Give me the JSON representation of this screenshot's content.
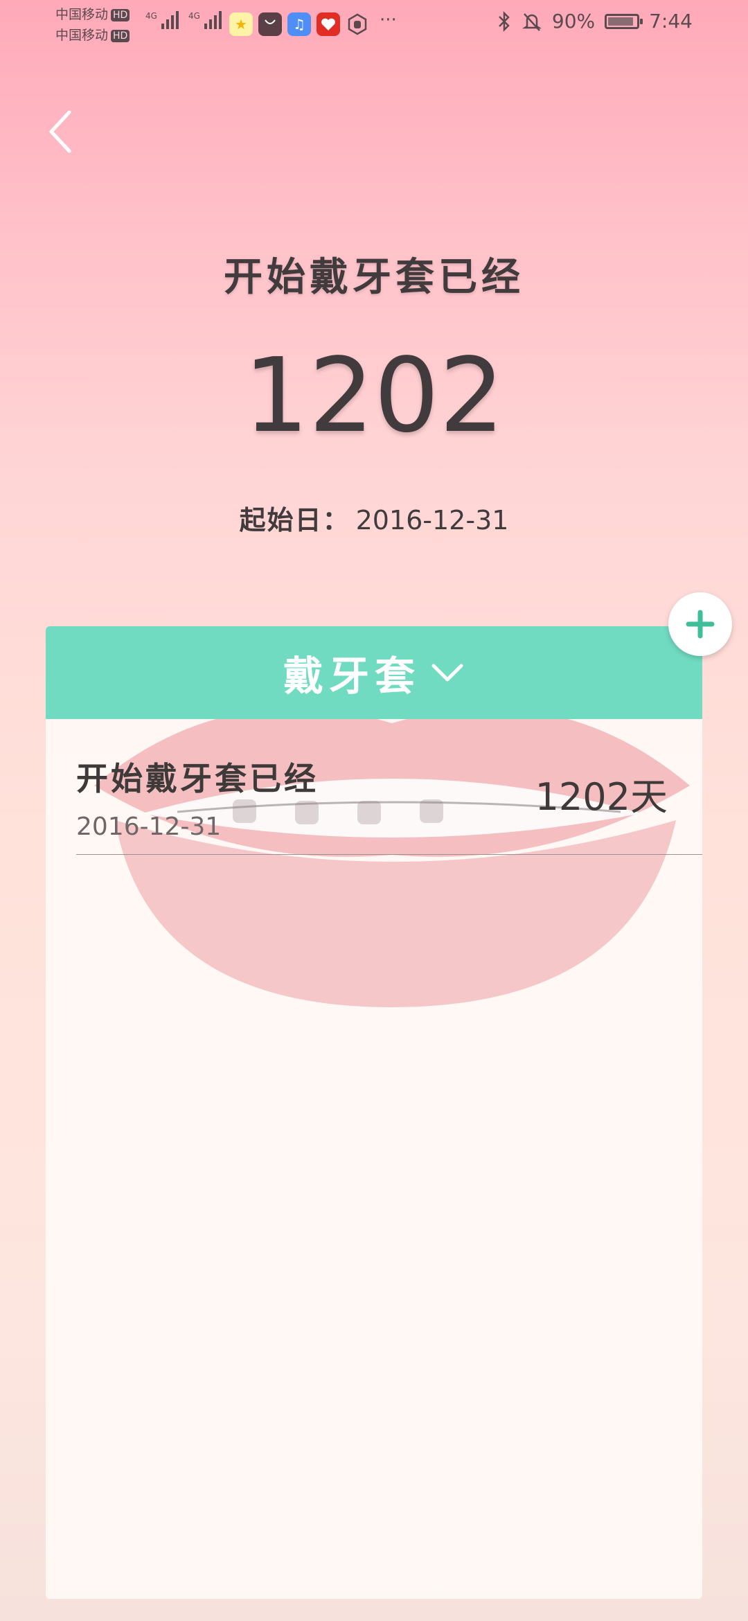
{
  "status_bar": {
    "carrier_1": "中国移动",
    "carrier_2": "中国移动",
    "hd_1": "HD",
    "hd_2": "HD",
    "network_1": "4G",
    "network_2": "4G",
    "battery_percent": "90%",
    "battery_level": 0.9,
    "time": "7:44",
    "more": "···",
    "icons": [
      "star-app-icon",
      "store-app-icon",
      "music-app-icon",
      "pinduoduo-app-icon",
      "hand-app-icon",
      "bluetooth-icon",
      "mute-bell-icon",
      "battery-icon"
    ]
  },
  "header": {
    "title": "开始戴牙套已经",
    "days": "1202",
    "start_label": "起始日：",
    "start_date": "2016-12-31"
  },
  "card": {
    "category": "戴牙套",
    "items": [
      {
        "title": "开始戴牙套已经",
        "date": "2016-12-31",
        "days": "1202天"
      }
    ]
  },
  "colors": {
    "accent": "#71dbc2",
    "text": "#423b3d",
    "background_top": "#ffa9b9",
    "background_bottom": "#f7e1dc"
  }
}
